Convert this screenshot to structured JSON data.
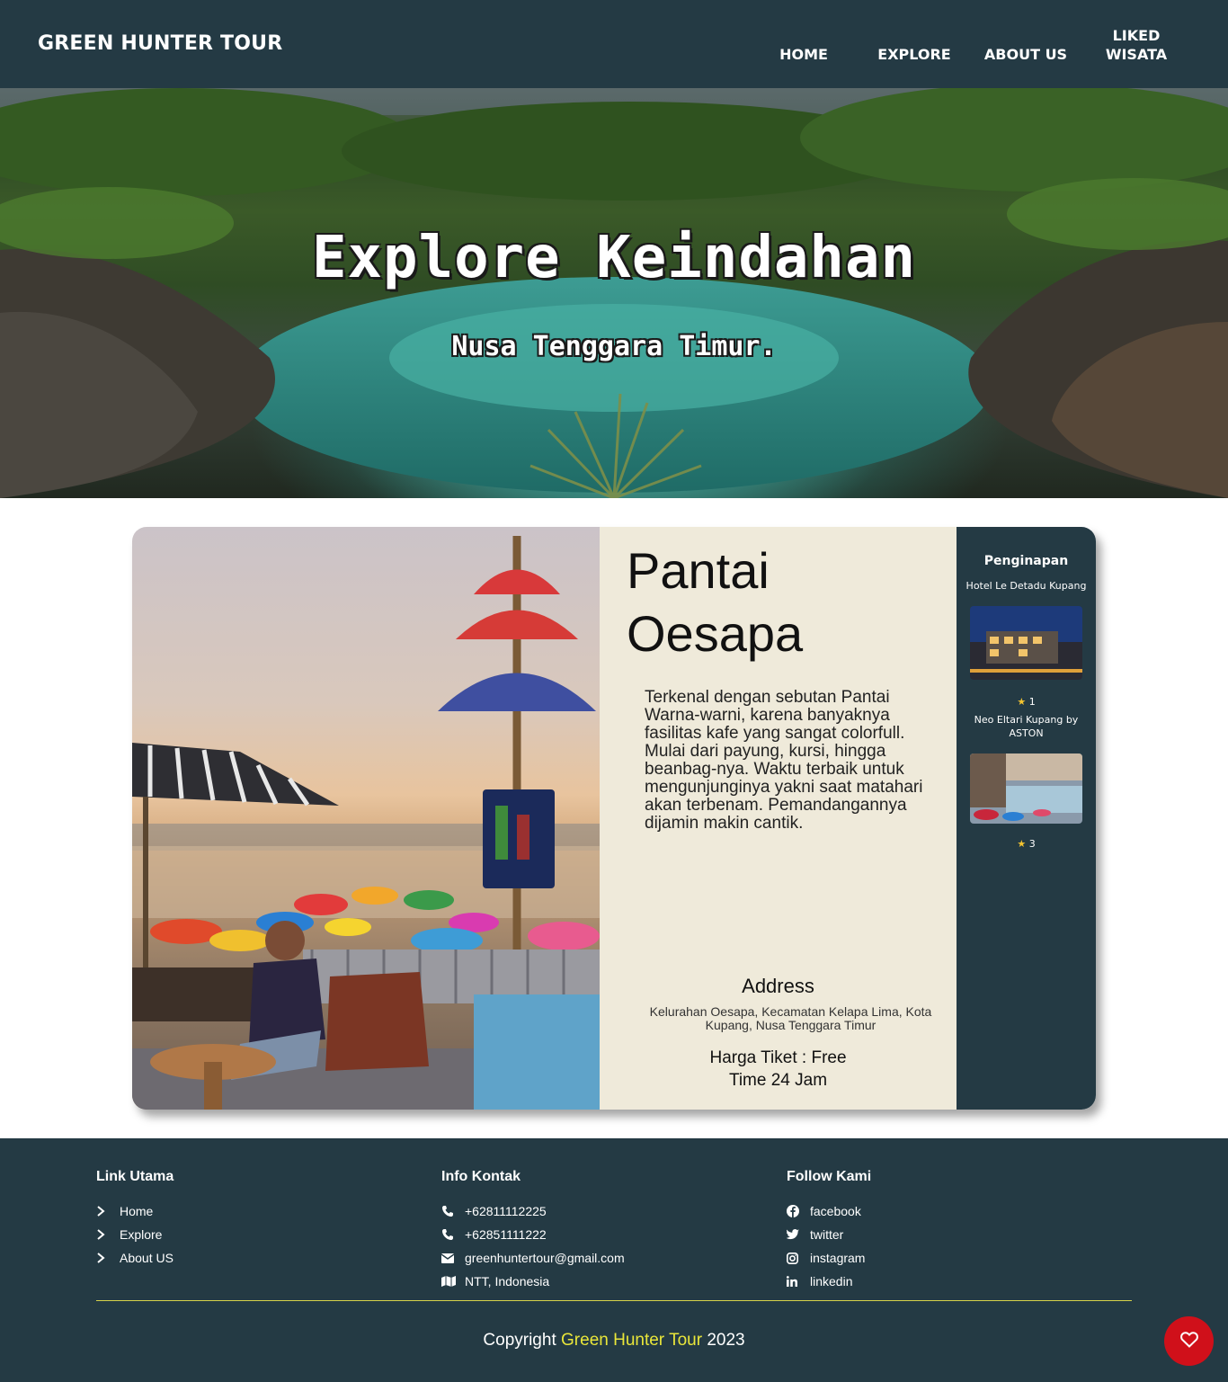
{
  "navbar": {
    "brand": "GREEN HUNTER TOUR",
    "links": [
      "HOME",
      "EXPLORE",
      "ABOUT US",
      "LIKED WISATA"
    ]
  },
  "hero": {
    "title": "Explore Keindahan",
    "subtitle": "Nusa Tenggara Timur."
  },
  "destination": {
    "title": "Pantai Oesapa",
    "description": "Terkenal dengan sebutan Pantai Warna-warni, karena banyaknya fasilitas kafe yang sangat colorfull. Mulai dari payung, kursi, hingga beanbag-nya. Waktu terbaik untuk mengunjunginya yakni saat matahari akan terbenam. Pemandangannya dijamin makin cantik.",
    "address_label": "Address",
    "address": "Kelurahan Oesapa, Kecamatan Kelapa Lima, Kota Kupang, Nusa Tenggara Timur",
    "ticket": "Harga Tiket : Free",
    "time": "Time 24 Jam"
  },
  "lodging": {
    "title": "Penginapan",
    "hotels": [
      {
        "name": "Hotel Le Detadu Kupang",
        "rating": "1"
      },
      {
        "name": "Neo Eltari Kupang by ASTON",
        "rating": "3"
      }
    ]
  },
  "footer": {
    "links_title": "Link Utama",
    "links": [
      "Home",
      "Explore",
      "About US"
    ],
    "contact_title": "Info Kontak",
    "contacts": [
      {
        "icon": "phone-icon",
        "text": "+62811112225"
      },
      {
        "icon": "phone-icon",
        "text": "+62851111222"
      },
      {
        "icon": "envelope-icon",
        "text": "greenhuntertour@gmail.com"
      },
      {
        "icon": "map-icon",
        "text": "NTT, Indonesia"
      }
    ],
    "follow_title": "Follow Kami",
    "socials": [
      {
        "icon": "facebook-icon",
        "text": "facebook"
      },
      {
        "icon": "twitter-icon",
        "text": "twitter"
      },
      {
        "icon": "instagram-icon",
        "text": "instagram"
      },
      {
        "icon": "linkedin-icon",
        "text": "linkedin"
      }
    ],
    "copyright_prefix": "Copyright",
    "copyright_brand": "Green Hunter Tour",
    "copyright_year": "2023"
  },
  "colors": {
    "primary": "#243a44",
    "card_bg": "#efeada",
    "accent": "#e9e63a",
    "like_button": "#d0101a",
    "star": "#f4c430"
  }
}
